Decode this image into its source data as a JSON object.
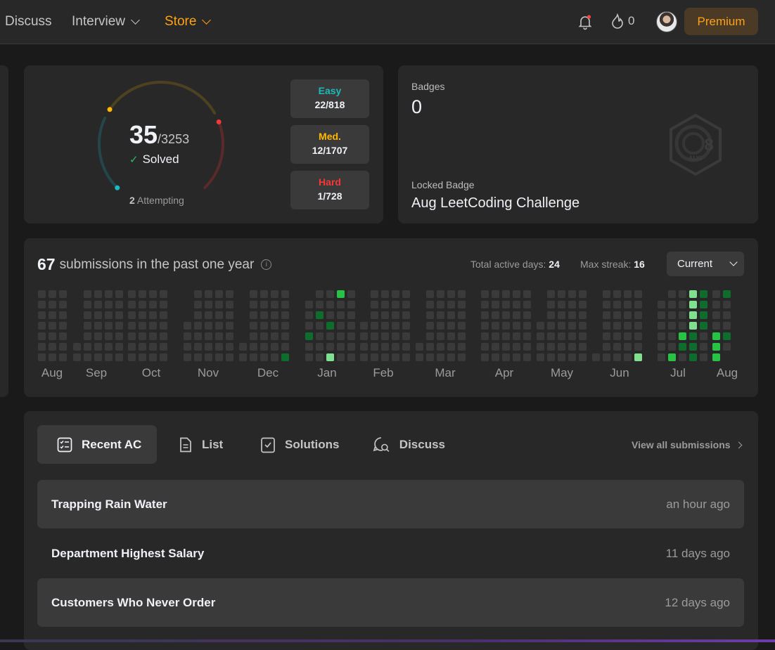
{
  "nav": {
    "discuss": "Discuss",
    "interview": "Interview",
    "store": "Store",
    "streak_count": "0",
    "premium": "Premium"
  },
  "solved": {
    "count": "35",
    "total": "/3253",
    "label": "Solved",
    "attempting_count": "2",
    "attempting_label": "Attempting",
    "easy_label": "Easy",
    "easy_count": "22/818",
    "medium_label": "Med.",
    "medium_count": "12/1707",
    "hard_label": "Hard",
    "hard_count": "1/728",
    "colors": {
      "easy": "#1cbaba",
      "medium": "#ffb700",
      "hard": "#f63737"
    }
  },
  "badges": {
    "label": "Badges",
    "count": "0",
    "locked_label": "Locked Badge",
    "locked_name": "Aug LeetCoding Challenge",
    "badge_icon_text": "8",
    "badge_icon_sub": "AUG"
  },
  "calendar": {
    "count": "67",
    "title": "submissions in the past one year",
    "active_days_label": "Total active days:",
    "active_days": "24",
    "max_streak_label": "Max streak:",
    "max_streak": "16",
    "range": "Current",
    "months": [
      "Aug",
      "Sep",
      "Oct",
      "Nov",
      "Dec",
      "Jan",
      "Feb",
      "Mar",
      "Apr",
      "May",
      "Jun",
      "Jul",
      "Aug"
    ],
    "colors": {
      "empty": "#3a3a3a",
      "low": "#0e6d2d",
      "mid": "#28c244",
      "high": "#7fe08f"
    }
  },
  "tabs": {
    "recent_ac": "Recent AC",
    "list": "List",
    "solutions": "Solutions",
    "discuss": "Discuss",
    "view_all": "View all submissions"
  },
  "submissions": [
    {
      "title": "Trapping Rain Water",
      "time": "an hour ago"
    },
    {
      "title": "Department Highest Salary",
      "time": "11 days ago"
    },
    {
      "title": "Customers Who Never Order",
      "time": "12 days ago"
    }
  ]
}
